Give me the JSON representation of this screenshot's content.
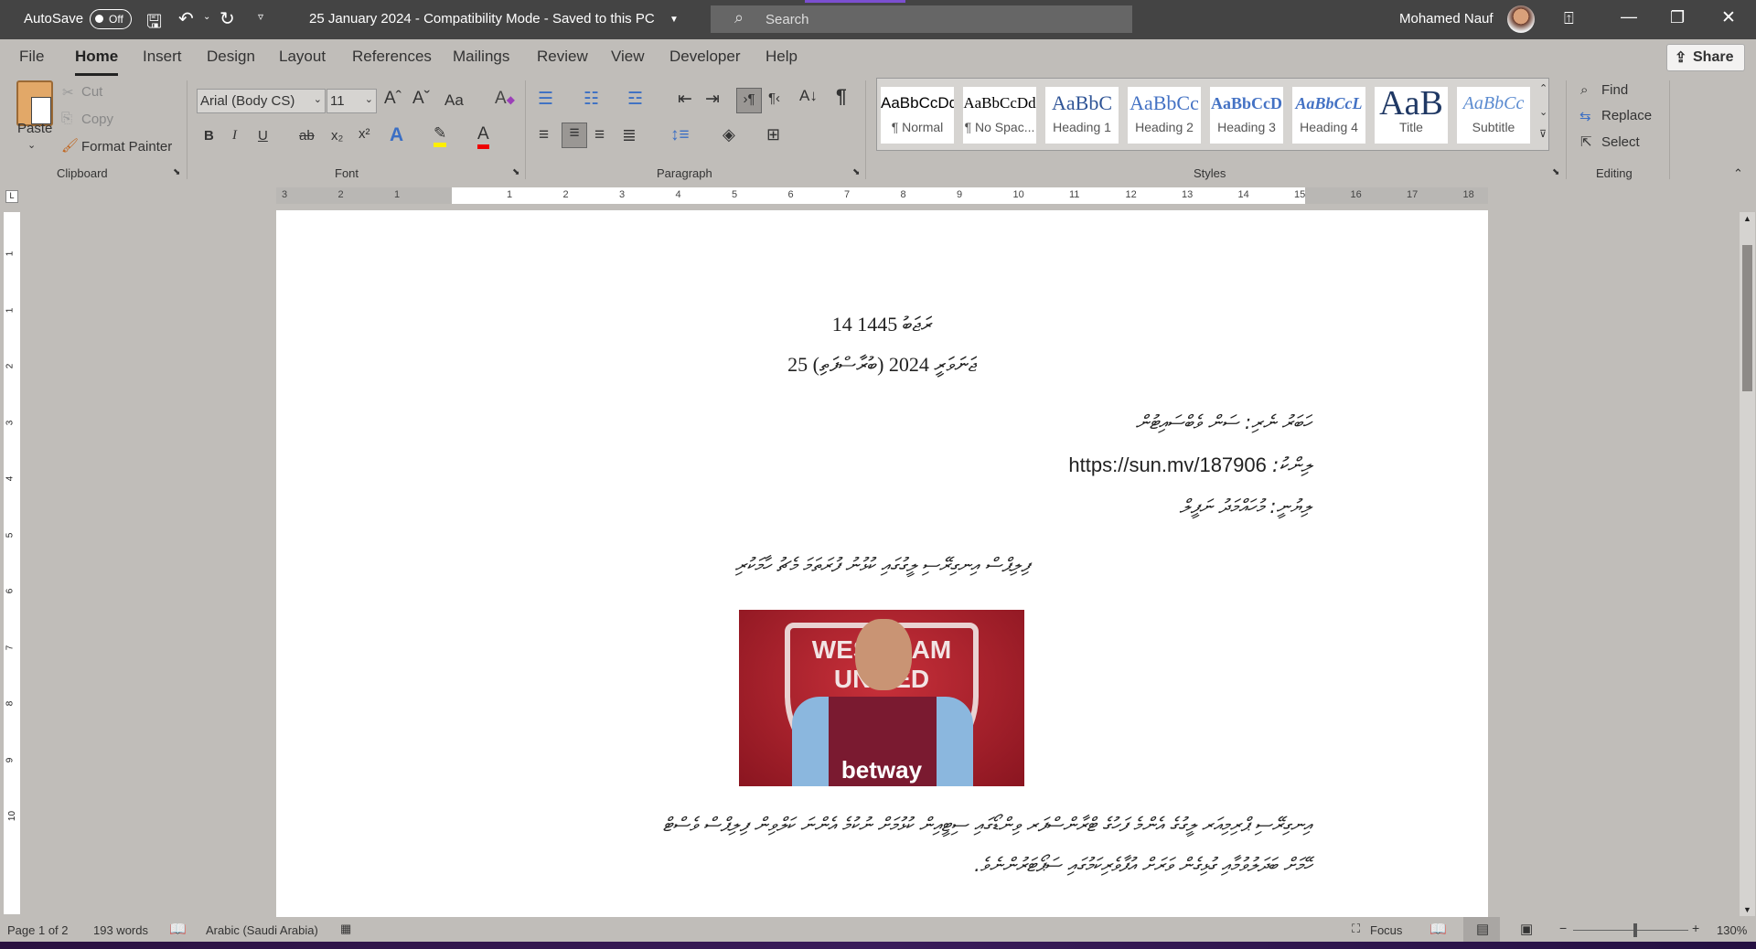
{
  "titlebar": {
    "autosave": "AutoSave",
    "autosave_state": "Off",
    "doc_title": "25 January 2024  -  Compatibility Mode  -  Saved to this PC",
    "search_placeholder": "Search",
    "user": "Mohamed Nauf"
  },
  "tabs": [
    "File",
    "Home",
    "Insert",
    "Design",
    "Layout",
    "References",
    "Mailings",
    "Review",
    "View",
    "Developer",
    "Help"
  ],
  "share": "Share",
  "clipboard": {
    "paste": "Paste",
    "cut": "Cut",
    "copy": "Copy",
    "format_painter": "Format Painter",
    "label": "Clipboard"
  },
  "font": {
    "name": "Arial (Body CS)",
    "size": "11",
    "label": "Font",
    "bold": "B",
    "italic": "I",
    "underline": "U",
    "strike": "ab",
    "sub": "x₂",
    "sup": "x²",
    "case": "Aa"
  },
  "paragraph": {
    "label": "Paragraph",
    "pilcrow": "¶"
  },
  "styles": {
    "label": "Styles",
    "items": [
      {
        "preview": "AaBbCcDd",
        "name": "¶ Normal"
      },
      {
        "preview": "AaBbCcDd",
        "name": "¶ No Spac..."
      },
      {
        "preview": "AaBbC",
        "name": "Heading 1"
      },
      {
        "preview": "AaBbCc",
        "name": "Heading 2"
      },
      {
        "preview": "AaBbCcD",
        "name": "Heading 3"
      },
      {
        "preview": "AaBbCcL",
        "name": "Heading 4"
      },
      {
        "preview": "AaB",
        "name": "Title"
      },
      {
        "preview": "AaBbCc",
        "name": "Subtitle"
      }
    ]
  },
  "editing": {
    "find": "Find",
    "replace": "Replace",
    "select": "Select",
    "label": "Editing"
  },
  "ruler": [
    "3",
    "2",
    "1",
    "",
    "1",
    "2",
    "3",
    "4",
    "5",
    "6",
    "7",
    "8",
    "9",
    "10",
    "11",
    "12",
    "13",
    "14",
    "15",
    "16",
    "17",
    "18"
  ],
  "vruler": [
    "1",
    "1",
    "2",
    "3",
    "4",
    "5",
    "6",
    "7",
    "8",
    "9",
    "10"
  ],
  "document": {
    "hijri_date": "14 ރަޖަބު 1445",
    "date": "25 ޖަނަވަރީ 2024 (ބުރާސްފަތި)",
    "source": "ހަބަރު ނެރި: ސަން ވެބްސައިޓުން",
    "link_label": "ލިންކު:",
    "link": "https://sun.mv/187906",
    "author": "ލިޔުނީ:  މުހައްމަދު ނަފީލް",
    "headline": "ފިލިޕްސް އިނގިރޭސި ލީގުގައި ކުޅުނު ފުރަތަމަ މެޗު ހާމަކުރި",
    "image_text": "betway",
    "image_crest": "WEST HAM UNITED",
    "para_line1": "އިނގިރޭސި ޕްރިމިއަރ ލީގުގެ އެންމެ ފަހުގެ ޓްރާންސްފަރ ވިންޑޯގައި ސިޓީއިން ކުޅުމަށް ނުކުމެ އެންނަ ކަލްވިން ފިލިޕްސް ވެސްޓް",
    "para_line2": "ހޭމަށް ބަދަލުވުމާއި ގުޅިގެން ވަރަށް އުފާވެރިކަމުގައި ސަޕޯޓަރުންނެވެ."
  },
  "status": {
    "page": "Page 1 of 2",
    "words": "193 words",
    "language": "Arabic (Saudi Arabia)",
    "focus": "Focus",
    "zoom": "130%"
  },
  "zoom_level_percent": 130
}
